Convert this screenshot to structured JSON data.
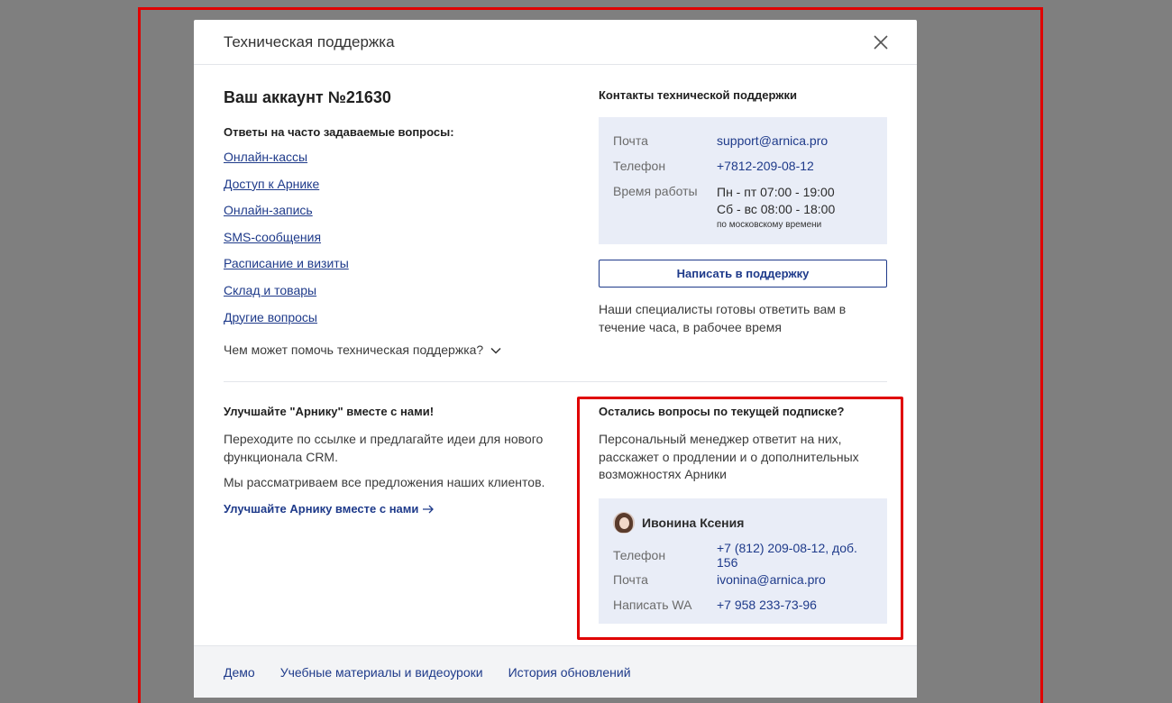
{
  "modal": {
    "title": "Техническая поддержка"
  },
  "account": {
    "title": "Ваш аккаунт №21630"
  },
  "faq": {
    "heading": "Ответы на часто задаваемые вопросы:",
    "links": [
      "Онлайн-кассы",
      "Доступ к Арнике",
      "Онлайн-запись",
      "SMS-сообщения",
      "Расписание и визиты",
      "Склад и товары",
      "Другие вопросы"
    ],
    "help_toggle": "Чем может помочь техническая поддержка?"
  },
  "contacts": {
    "heading": "Контакты технической поддержки",
    "email_label": "Почта",
    "email": "support@arnica.pro",
    "phone_label": "Телефон",
    "phone": "+7812-209-08-12",
    "hours_label": "Время работы",
    "hours_weekdays": "Пн - пт 07:00 - 19:00",
    "hours_weekend": "Сб - вс 08:00 - 18:00",
    "hours_note": "по московскому времени",
    "write_button": "Написать в поддержку",
    "specialists_text": "Наши специалисты готовы ответить вам в течение часа, в рабочее время"
  },
  "improve": {
    "heading": "Улучшайте \"Арнику\" вместе с нами!",
    "text1": "Переходите по ссылке и предлагайте идеи для нового функционала CRM.",
    "text2": "Мы рассматриваем все предложения наших клиентов.",
    "link": "Улучшайте Арнику вместе с нами"
  },
  "subscription": {
    "heading": "Остались вопросы по текущей подписке?",
    "text": "Персональный менеджер ответит на них, расскажет о продлении и о дополнительных возможностях Арники",
    "manager_name": "Ивонина Ксения",
    "phone_label": "Телефон",
    "phone": "+7 (812) 209-08-12, доб. 156",
    "email_label": "Почта",
    "email": "ivonina@arnica.pro",
    "wa_label": "Написать WA",
    "wa": "+7 958 233-73-96"
  },
  "footer": {
    "links": [
      "Демо",
      "Учебные материалы и видеоуроки",
      "История обновлений"
    ]
  },
  "colors": {
    "accent": "#1e3a8a",
    "highlight_border": "#e00000",
    "info_box_bg": "#e9edf7"
  },
  "icons": {
    "close": "close-icon",
    "chevron": "chevron-down-icon",
    "arrow": "arrow-right-icon"
  }
}
